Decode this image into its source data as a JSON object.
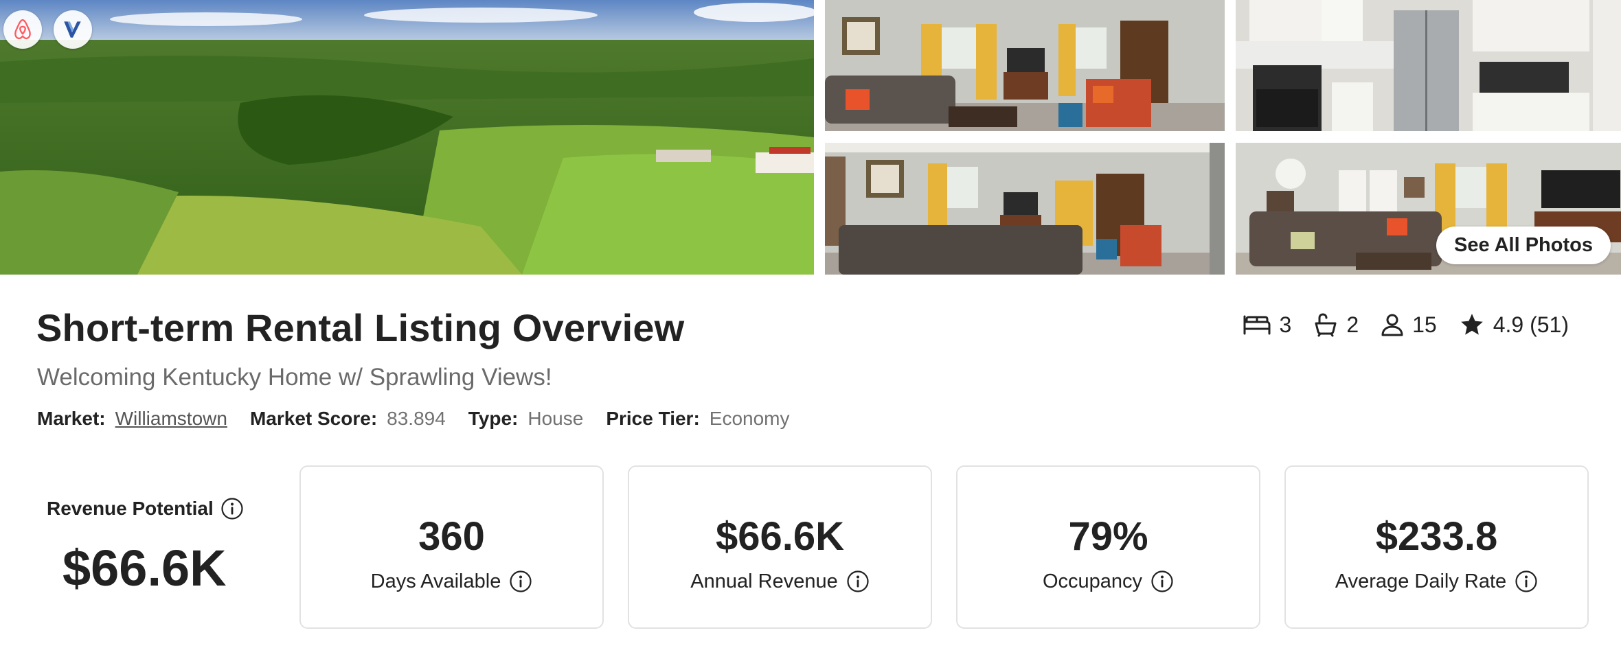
{
  "gallery": {
    "see_all_label": "See All Photos"
  },
  "badges": [
    "airbnb-icon",
    "vrbo-icon"
  ],
  "header": {
    "title": "Short-term Rental Listing Overview",
    "subtitle": "Welcoming Kentucky Home w/ Sprawling Views!",
    "meta": {
      "market_label": "Market:",
      "market_value": "Williamstown",
      "score_label": "Market Score:",
      "score_value": "83.894",
      "type_label": "Type:",
      "type_value": "House",
      "tier_label": "Price Tier:",
      "tier_value": "Economy"
    }
  },
  "stats": {
    "bedrooms": "3",
    "bathrooms": "2",
    "guests": "15",
    "rating": "4.9 (51)"
  },
  "revenue_potential": {
    "label": "Revenue Potential",
    "value": "$66.6K"
  },
  "metrics": [
    {
      "value": "360",
      "label": "Days Available"
    },
    {
      "value": "$66.6K",
      "label": "Annual Revenue"
    },
    {
      "value": "79%",
      "label": "Occupancy"
    },
    {
      "value": "$233.8",
      "label": "Average Daily Rate"
    }
  ],
  "colors": {
    "text": "#222222",
    "muted": "#717171",
    "card_border": "#e2e2e2",
    "airbnb": "#ff5a5f"
  }
}
